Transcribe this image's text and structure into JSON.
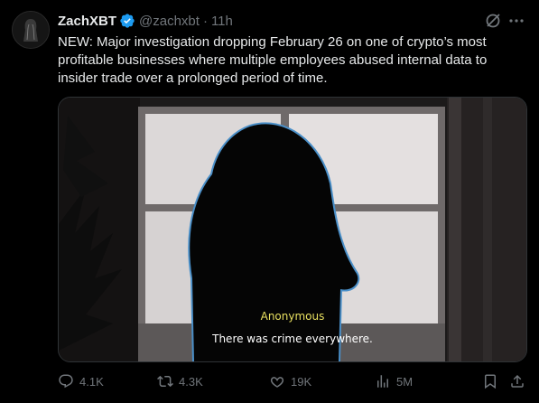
{
  "author": {
    "name": "ZachXBT",
    "handle": "@zachxbt",
    "separator": "·",
    "time": "11h"
  },
  "tweet": {
    "text": "NEW: Major investigation dropping February 26 on one of crypto’s most profitable businesses where multiple employees abused internal data to insider trade over a prolonged period of time."
  },
  "media": {
    "caption_speaker": "Anonymous",
    "caption_line": "There was crime everywhere."
  },
  "actions": {
    "replies": "4.1K",
    "reposts": "4.3K",
    "likes": "19K",
    "views": "5M"
  },
  "icons": {
    "verified": "verified-badge-icon",
    "grok": "grok-icon",
    "more": "more-icon",
    "reply": "reply-icon",
    "repost": "repost-icon",
    "like": "like-icon",
    "views": "views-icon",
    "bookmark": "bookmark-icon",
    "share": "share-icon"
  },
  "colors": {
    "background": "#000000",
    "text": "#e7e9ea",
    "muted": "#71767b",
    "verified": "#1d9bf0",
    "caption_speaker": "#e8e060"
  }
}
